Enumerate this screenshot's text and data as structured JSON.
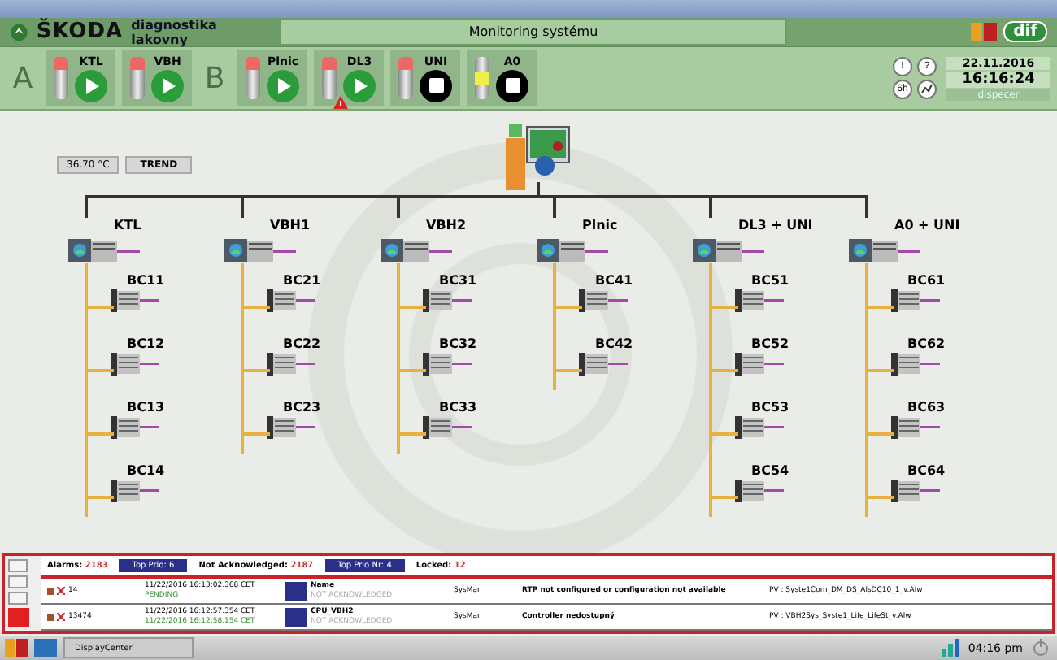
{
  "header": {
    "brand": "ŠKODA",
    "subtitle": "diagnostika lakovny",
    "screen_title": "Monitoring systému",
    "partner_logo": "dif"
  },
  "groups": [
    {
      "letter": "A",
      "lines": [
        {
          "name": "KTL",
          "fault": true,
          "caution": false,
          "running": true,
          "alert": false
        },
        {
          "name": "VBH",
          "fault": true,
          "caution": false,
          "running": true,
          "alert": false
        }
      ]
    },
    {
      "letter": "B",
      "lines": [
        {
          "name": "Plnic",
          "fault": true,
          "caution": false,
          "running": true,
          "alert": false
        },
        {
          "name": "DL3",
          "fault": true,
          "caution": false,
          "running": true,
          "alert": true
        },
        {
          "name": "UNI",
          "fault": true,
          "caution": false,
          "running": false,
          "alert": false
        },
        {
          "name": "A0",
          "fault": false,
          "caution": true,
          "running": false,
          "alert": false
        }
      ]
    }
  ],
  "status": {
    "icons": [
      "!",
      "?",
      "6h"
    ],
    "date": "22.11.2016",
    "time": "16:16:24",
    "user": "dispecer"
  },
  "temperature": "36.70 °C",
  "trend_button": "TREND",
  "network": {
    "stations": [
      {
        "name": "KTL",
        "nodes": [
          "BC11",
          "BC12",
          "BC13",
          "BC14"
        ]
      },
      {
        "name": "VBH1",
        "nodes": [
          "BC21",
          "BC22",
          "BC23"
        ]
      },
      {
        "name": "VBH2",
        "nodes": [
          "BC31",
          "BC32",
          "BC33"
        ]
      },
      {
        "name": "Plnic",
        "nodes": [
          "BC41",
          "BC42"
        ]
      },
      {
        "name": "DL3 + UNI",
        "nodes": [
          "BC51",
          "BC52",
          "BC53",
          "BC54"
        ]
      },
      {
        "name": "A0 + UNI",
        "nodes": [
          "BC61",
          "BC62",
          "BC63",
          "BC64"
        ]
      }
    ]
  },
  "alarms": {
    "summary": [
      {
        "label": "Alarms:",
        "value": "2183",
        "kind": "text"
      },
      {
        "label": "Top Prio:",
        "value": "6",
        "kind": "box"
      },
      {
        "label": "Not Acknowledged:",
        "value": "2187",
        "kind": "text"
      },
      {
        "label": "Top Prio Nr:",
        "value": "4",
        "kind": "box"
      },
      {
        "label": "Locked:",
        "value": "12",
        "kind": "text"
      }
    ],
    "rows": [
      {
        "id": "14",
        "time": "11/22/2016 16:13:02.368 CET",
        "state": "PENDING",
        "name": "Name",
        "ack": "NOT ACKNOWLEDGED",
        "source": "SysMan",
        "message": "RTP not configured or configuration not available",
        "pv": "PV : Syste1Com_DM_DS_AlsDC10_1_v.Alw"
      },
      {
        "id": "13474",
        "time": "11/22/2016 16:12:57.354 CET",
        "state": "11/22/2016 16:12:58.154 CET",
        "name": "CPU_VBH2",
        "ack": "NOT ACKNOWLEDGED",
        "source": "SysMan",
        "message": "Controller nedostupný",
        "pv": "PV : VBH2Sys_Syste1_Life_LifeSt_v.Alw"
      }
    ]
  },
  "taskbar": {
    "app": "DisplayCenter",
    "clock": "04:16 pm"
  }
}
